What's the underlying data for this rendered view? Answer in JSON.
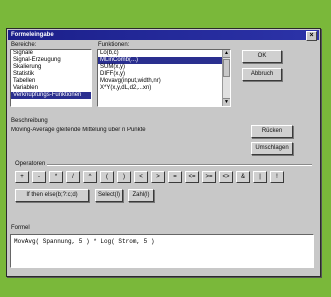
{
  "window": {
    "title": "Formeleingabe",
    "close": "×"
  },
  "categories": {
    "label": "Bereiche:",
    "items": [
      "Signale",
      "Signal-Erzeugung",
      "Skalierung",
      "Statistik",
      "Tabellen",
      "Variablen",
      "Verknüpfungs-Funktionen"
    ],
    "selected_index": 6
  },
  "functions": {
    "label": "Funktionen:",
    "items": [
      "Lo(b,c)",
      "MLinComb(...)",
      "SUM(x,y)",
      "DIFF(x,y)",
      "Movavg(input,width,nr)",
      "X*Y(x,y,dL,d2,...xn)"
    ],
    "selected_index": 1
  },
  "buttons": {
    "ok": "OK",
    "cancel": "Abbruch",
    "delete": "Rücken",
    "overwrite": "Umschlagen"
  },
  "description": {
    "label": "Beschreibung",
    "text": "Moving-Average gleitende Mittelung über n Punkte"
  },
  "operators": {
    "label": "Operatoren",
    "row1": [
      "+",
      "-",
      "*",
      "/",
      "^",
      "(",
      ")",
      "<",
      ">",
      "=",
      "<=",
      ">=",
      "<>",
      "&",
      "|",
      "!"
    ],
    "row2": [
      "If then else(b;?:c;d)",
      "Select(l)",
      "Zahl(l)"
    ]
  },
  "formula": {
    "label": "Formel",
    "text": "MovAvg( Spannung, 5 ) * Log( Strom, 5 )"
  }
}
